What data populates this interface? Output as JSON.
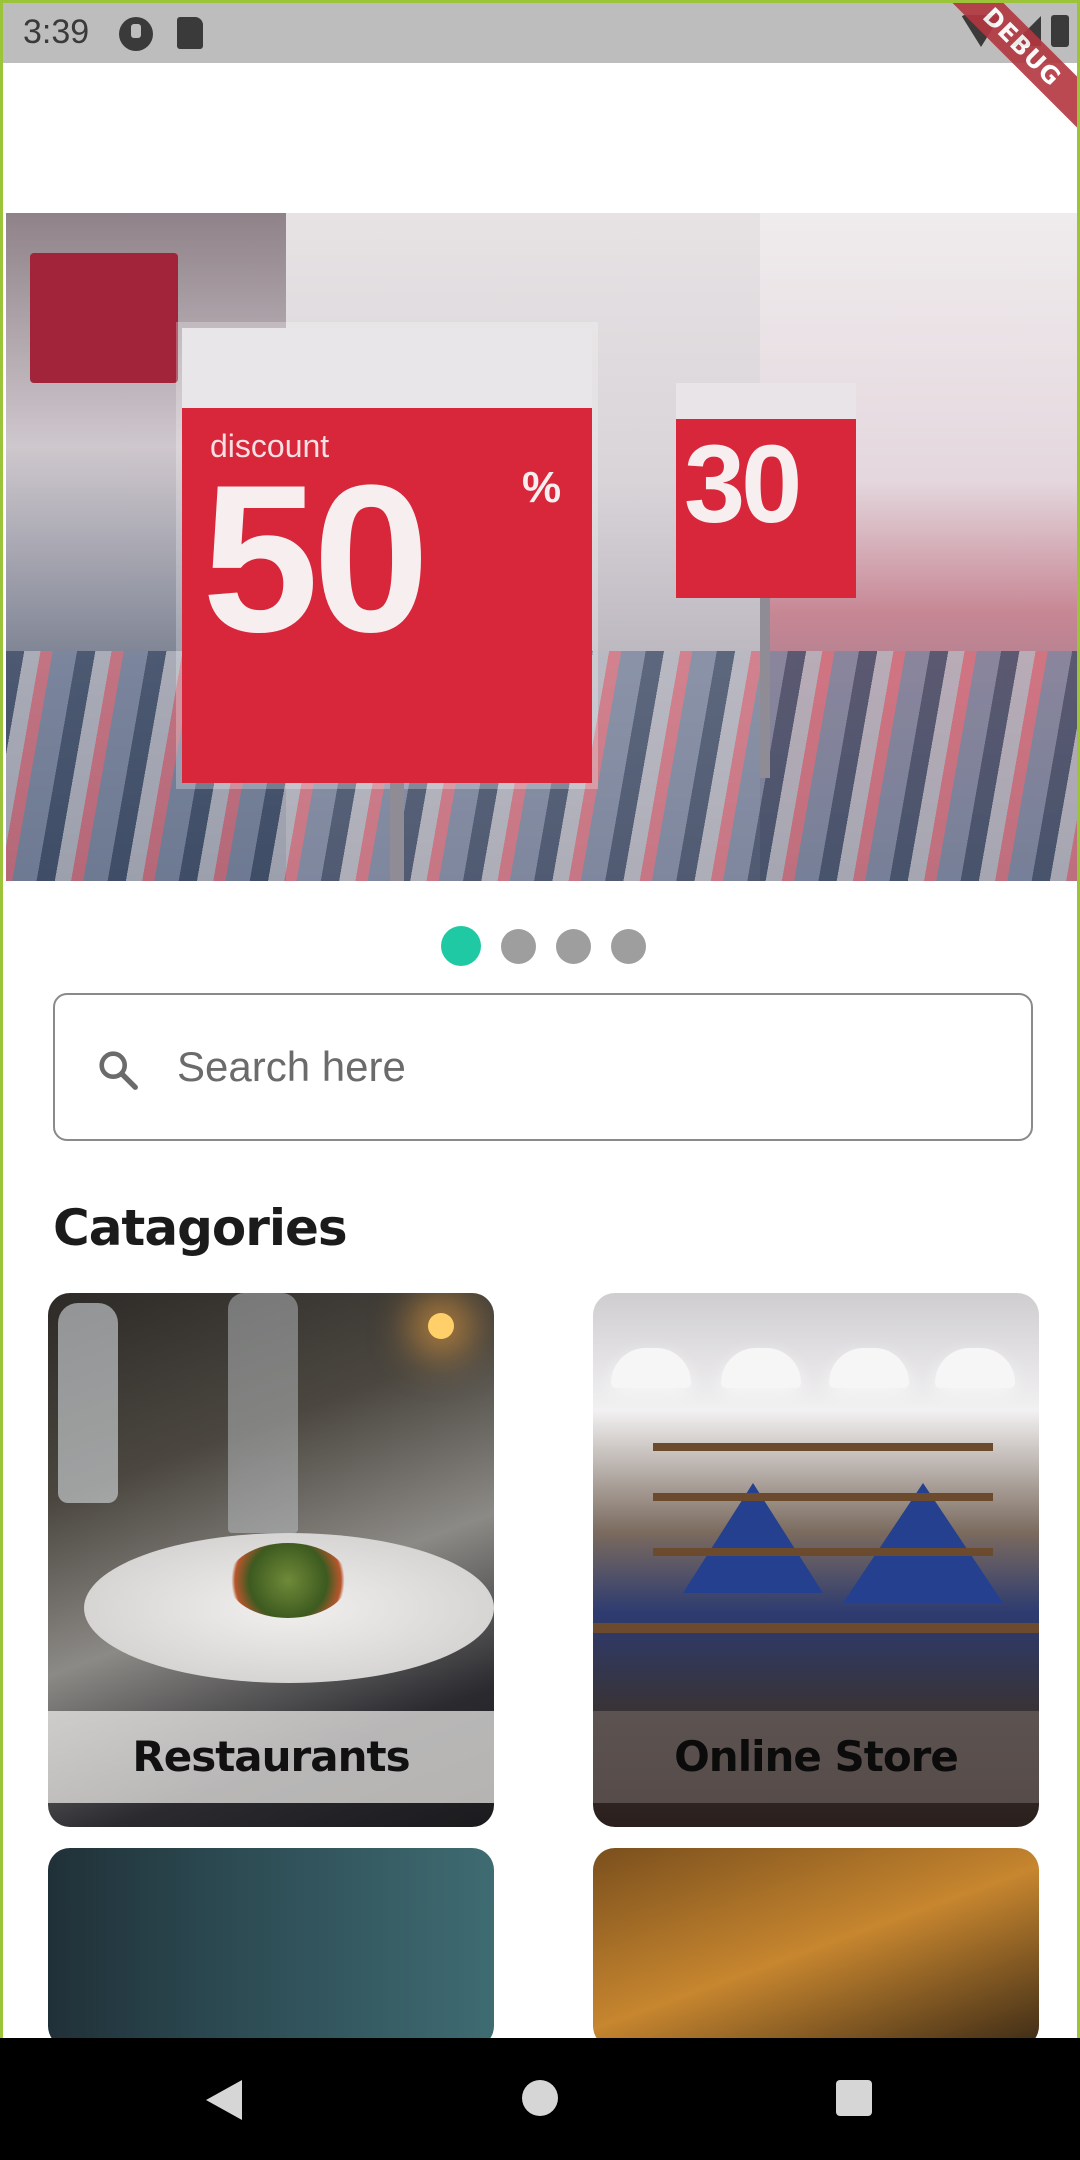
{
  "status_bar": {
    "time": "3:39",
    "debug_label": "DEBUG"
  },
  "banner": {
    "sign_main_label": "discount",
    "sign_main_value": "50",
    "sign_main_percent": "%",
    "sign_small_value": "30",
    "carousel_pages": 4,
    "active_page": 1
  },
  "search": {
    "placeholder": "Search here",
    "value": ""
  },
  "categories": {
    "heading": "Catagories",
    "items": [
      {
        "label": "Restaurants"
      },
      {
        "label": "Online Store"
      },
      {
        "label": ""
      },
      {
        "label": ""
      }
    ]
  },
  "colors": {
    "accent": "#1ec9a4",
    "dot_inactive": "#9e9e9e",
    "frame_border": "#9bc43a",
    "debug_banner": "#b3363f"
  },
  "icons": {
    "search": "search-icon",
    "nav_back": "back-icon",
    "nav_home": "home-icon",
    "nav_recent": "recent-apps-icon"
  }
}
